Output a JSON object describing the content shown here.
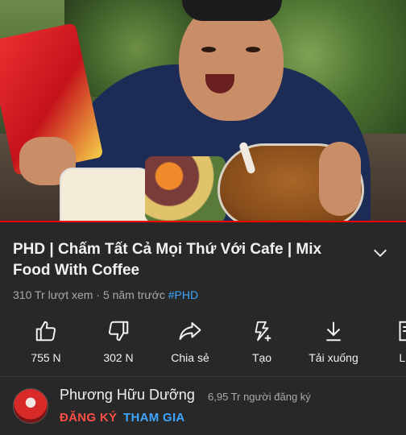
{
  "video": {
    "title": "PHD | Chấm Tất Cả Mọi Thứ Với Cafe | Mix Food With Coffee",
    "views": "310 Tr lượt xem",
    "separator": " · ",
    "age": "5 năm trước",
    "hashtag": "#PHD",
    "progress_percent": 100
  },
  "actions": [
    {
      "label": "755 N",
      "icon": "thumbs-up-icon"
    },
    {
      "label": "302 N",
      "icon": "thumbs-down-icon"
    },
    {
      "label": "Chia sẻ",
      "icon": "share-icon"
    },
    {
      "label": "Tạo",
      "icon": "create-clip-icon"
    },
    {
      "label": "Tải xuống",
      "icon": "download-icon"
    },
    {
      "label": "Lư",
      "icon": "save-playlist-icon"
    }
  ],
  "channel": {
    "name": "Phương Hữu Dưỡng",
    "subscribers": "6,95 Tr người đăng ký",
    "subscribe_label": "ĐĂNG KÝ",
    "join_label": "THAM GIA"
  },
  "colors": {
    "background": "#282828",
    "subscribe": "#ff4e45",
    "link": "#3ea6ff",
    "progress": "#ff0000"
  }
}
